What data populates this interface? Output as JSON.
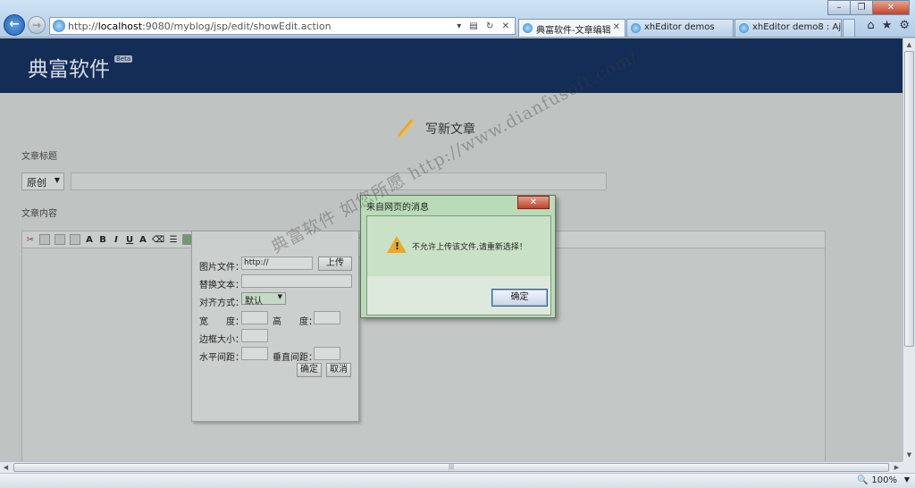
{
  "browser": {
    "url_prefix": "http://",
    "url_host": "localhost",
    "url_rest": ":9080/myblog/jsp/edit/showEdit.action",
    "tabs": [
      {
        "label": "典富软件-文章编辑"
      },
      {
        "label": "xhEditor demos"
      },
      {
        "label": "xhEditor demo8 : Aja..."
      }
    ],
    "zoom": "100%"
  },
  "site": {
    "brand": "典富软件",
    "badge": "Beta"
  },
  "form": {
    "heading": "写新文章",
    "title_label": "文章标题",
    "type_value": "原创",
    "content_label": "文章内容"
  },
  "image_dialog": {
    "file_label": "图片文件：",
    "file_value": "http://",
    "upload_btn": "上传",
    "alt_label": "替换文本：",
    "align_label": "对齐方式：",
    "align_value": "默认",
    "width_label": "宽　　度：",
    "height_label": "高　　度：",
    "border_label": "边框大小：",
    "hspace_label": "水平间距：",
    "vspace_label": "垂直间距：",
    "ok_btn": "确定",
    "cancel_btn": "取消"
  },
  "file_dialog_peek": "文件",
  "alert": {
    "title": "来自网页的消息",
    "message": "不允许上传该文件,请重新选择！",
    "ok": "确定"
  },
  "watermark": "典富软件 如您所愿  http://www.dianfusoft.com/"
}
